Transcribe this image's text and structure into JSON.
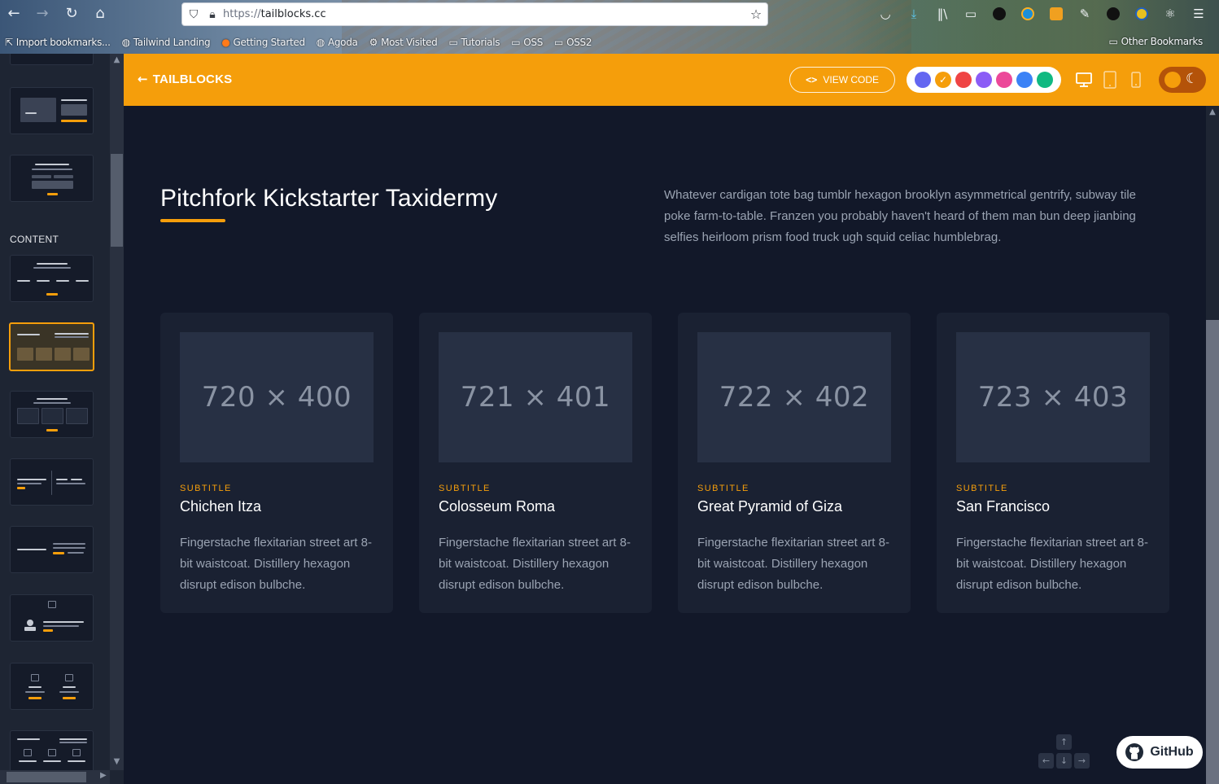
{
  "browser": {
    "url_protocol": "https://",
    "url_host": "tailblocks.cc",
    "bookmarks": [
      {
        "label": "Import bookmarks...",
        "icon": "import-icon"
      },
      {
        "label": "Tailwind Landing",
        "icon": "globe-icon"
      },
      {
        "label": "Getting Started",
        "icon": "firefox-icon"
      },
      {
        "label": "Agoda",
        "icon": "globe-icon"
      },
      {
        "label": "Most Visited",
        "icon": "gear-icon"
      },
      {
        "label": "Tutorials",
        "icon": "folder-icon"
      },
      {
        "label": "OSS",
        "icon": "folder-icon"
      },
      {
        "label": "OSS2",
        "icon": "folder-icon"
      }
    ],
    "other_bookmarks": "Other Bookmarks"
  },
  "sidebar": {
    "section_label": "CONTENT"
  },
  "appbar": {
    "brand": "TAILBLOCKS",
    "view_code": "VIEW CODE",
    "swatch_colors": [
      "#6366f1",
      "#f59e0b",
      "#ef4444",
      "#8b5cf6",
      "#ec4899",
      "#3b82f6",
      "#10b981"
    ],
    "selected_swatch": "#f59e0b",
    "accent": "#f59e0b"
  },
  "main": {
    "heading": "Pitchfork Kickstarter Taxidermy",
    "intro": "Whatever cardigan tote bag tumblr hexagon brooklyn asymmetrical gentrify, subway tile poke farm-to-table. Franzen you probably haven't heard of them man bun deep jianbing selfies heirloom prism food truck ugh squid celiac humblebrag.",
    "cards": [
      {
        "placeholder": "720 × 400",
        "subtitle": "SUBTITLE",
        "title": "Chichen Itza",
        "desc": "Fingerstache flexitarian street art 8-bit waistcoat. Distillery hexagon disrupt edison bulbche."
      },
      {
        "placeholder": "721 × 401",
        "subtitle": "SUBTITLE",
        "title": "Colosseum Roma",
        "desc": "Fingerstache flexitarian street art 8-bit waistcoat. Distillery hexagon disrupt edison bulbche."
      },
      {
        "placeholder": "722 × 402",
        "subtitle": "SUBTITLE",
        "title": "Great Pyramid of Giza",
        "desc": "Fingerstache flexitarian street art 8-bit waistcoat. Distillery hexagon disrupt edison bulbche."
      },
      {
        "placeholder": "723 × 403",
        "subtitle": "SUBTITLE",
        "title": "San Francisco",
        "desc": "Fingerstache flexitarian street art 8-bit waistcoat. Distillery hexagon disrupt edison bulbche."
      }
    ],
    "github_label": "GitHub"
  }
}
